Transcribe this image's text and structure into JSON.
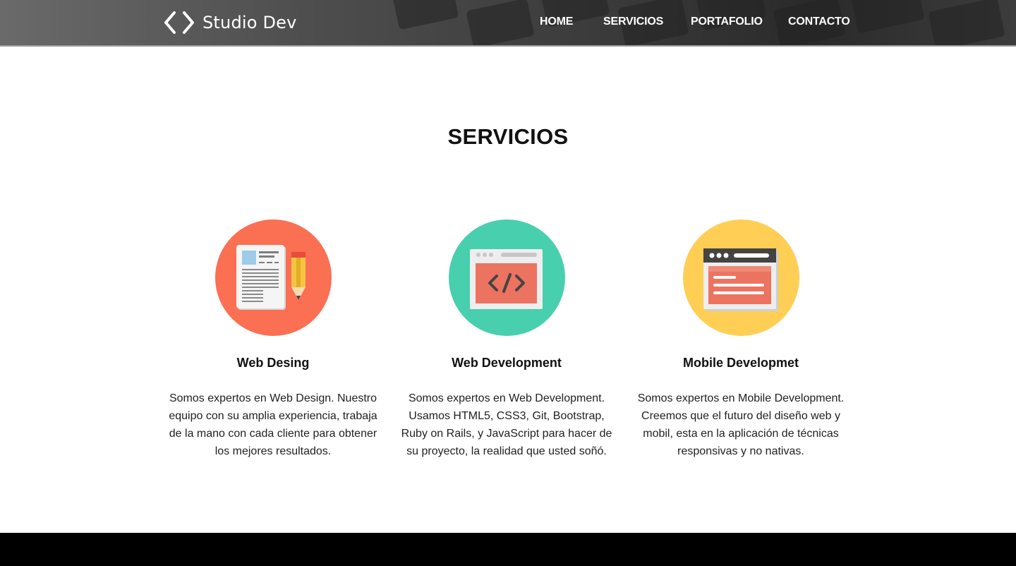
{
  "brand": {
    "name": "Studio Dev",
    "logo_icon": "code-brackets-icon"
  },
  "nav": {
    "items": [
      {
        "label": "HOME"
      },
      {
        "label": "SERVICIOS"
      },
      {
        "label": "PORTAFOLIO"
      },
      {
        "label": "CONTACTO"
      }
    ]
  },
  "services_section": {
    "title": "SERVICIOS",
    "items": [
      {
        "title": "Web Desing",
        "description": "Somos expertos en Web Design. Nuestro equipo con su amplia experiencia, trabaja de la mano con cada cliente para obtener los mejores resultados.",
        "icon": "document-pencil-icon",
        "color": "#fb6f52"
      },
      {
        "title": "Web Development",
        "description": "Somos expertos en Web Development. Usamos HTML5, CSS3, Git, Bootstrap, Ruby on Rails, y JavaScript para hacer de su proyecto, la realidad que usted soñó.",
        "icon": "code-window-icon",
        "color": "#48cfae"
      },
      {
        "title": "Mobile Developmet",
        "description": "Somos expertos en Mobile Development. Creemos que el futuro del diseño web y mobil, esta en la aplicación de técnicas responsivas y no nativas.",
        "icon": "browser-window-icon",
        "color": "#ffce54"
      }
    ]
  },
  "colors": {
    "header_bg": "#3a3a3a",
    "footer_bg": "#000000",
    "text": "#111111"
  }
}
